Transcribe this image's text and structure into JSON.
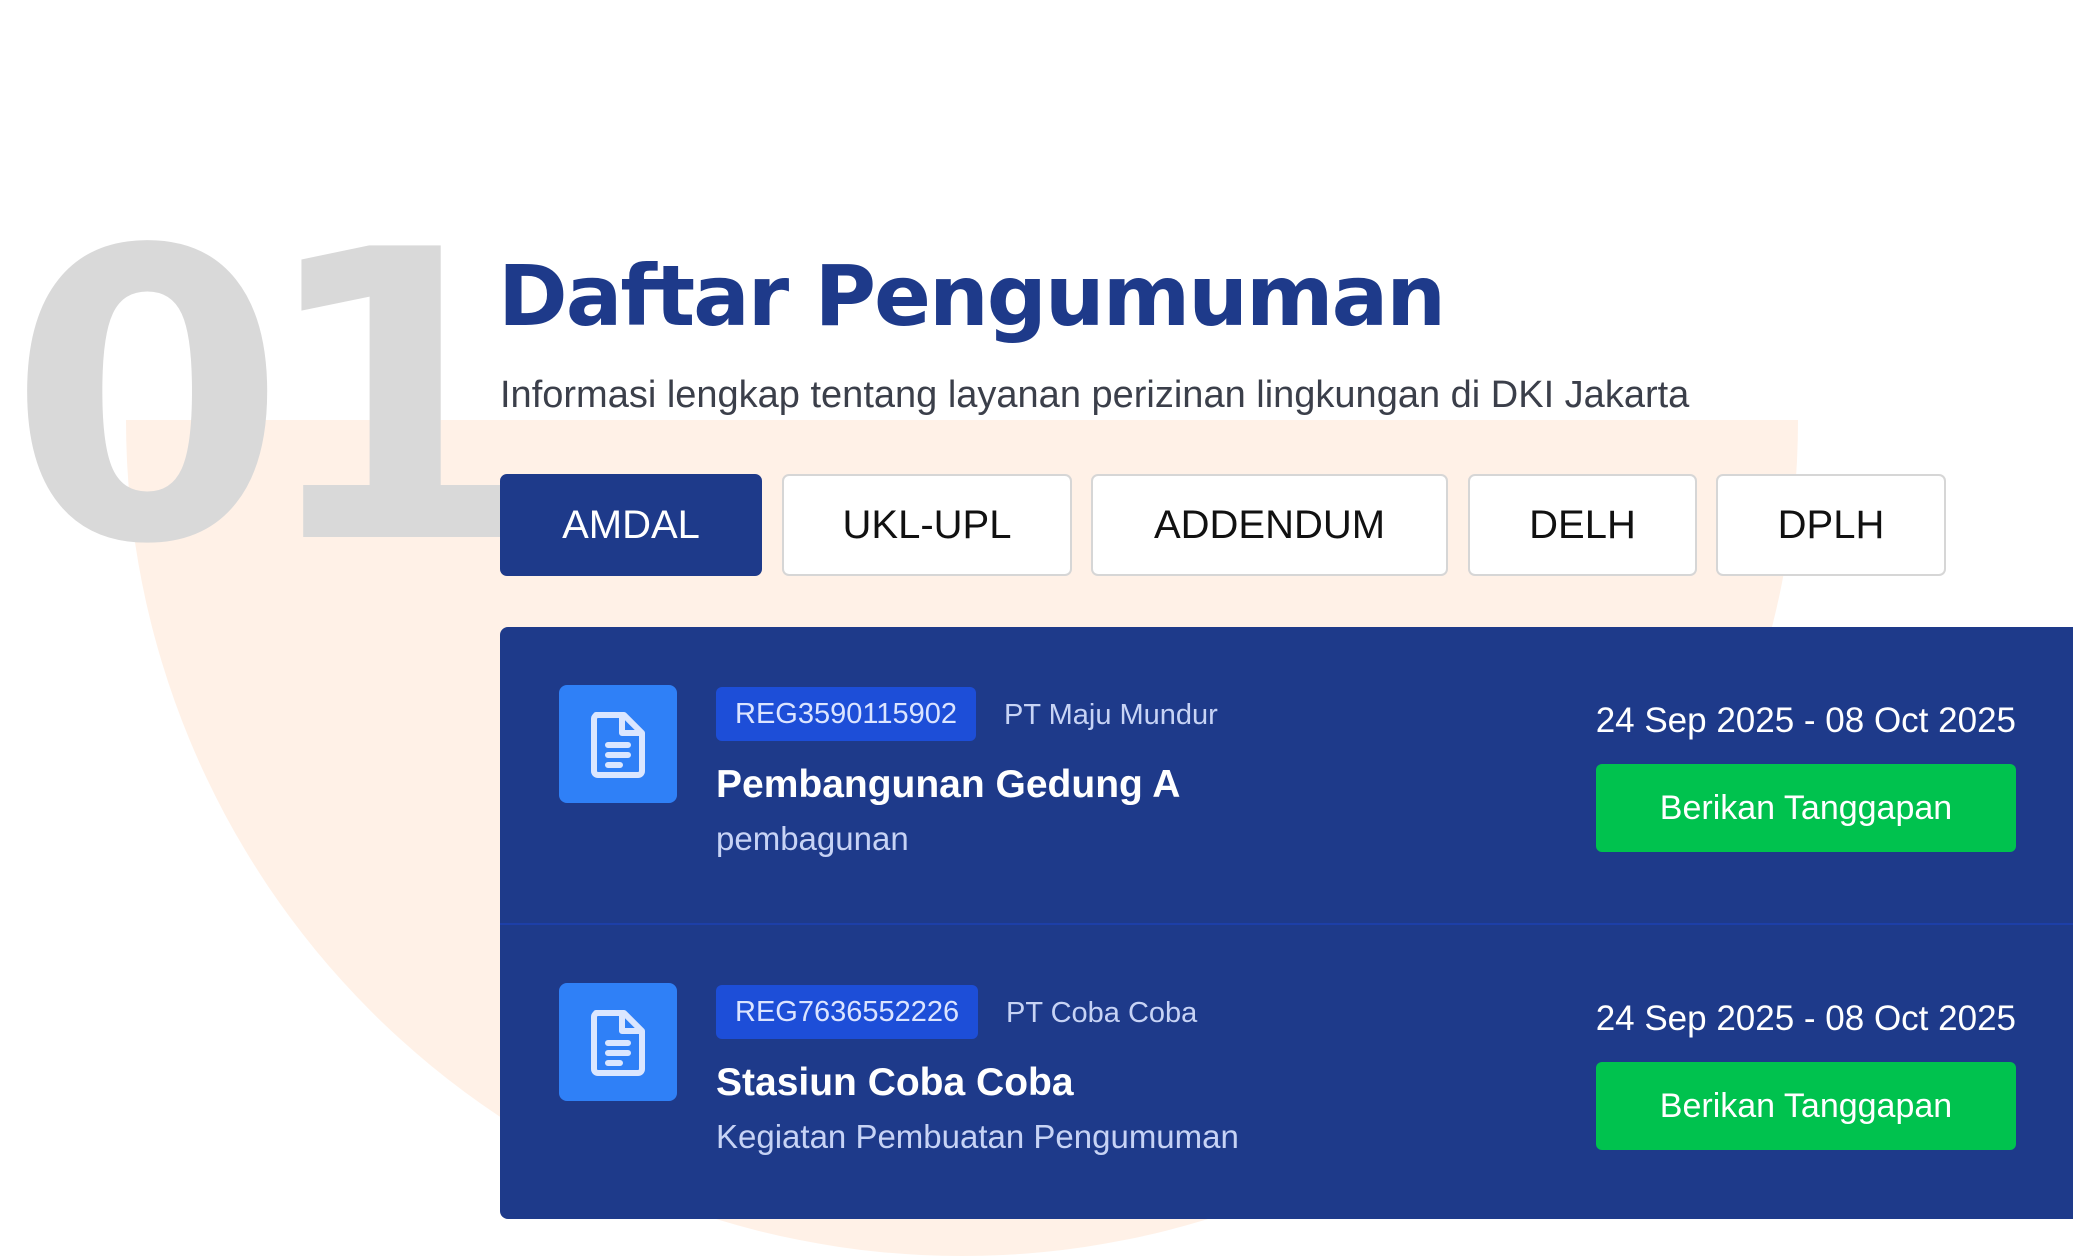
{
  "section": {
    "number": "01",
    "title": "Daftar Pengumuman",
    "subtitle": "Informasi lengkap tentang layanan perizinan lingkungan di DKI Jakarta"
  },
  "tabs": [
    {
      "label": "AMDAL",
      "active": true
    },
    {
      "label": "UKL-UPL",
      "active": false
    },
    {
      "label": "ADDENDUM",
      "active": false
    },
    {
      "label": "DELH",
      "active": false
    },
    {
      "label": "DPLH",
      "active": false
    }
  ],
  "announcements": [
    {
      "icon": "document-icon",
      "reg_number": "REG3590115902",
      "company": "PT Maju Mundur",
      "title": "Pembangunan Gedung A",
      "category": "pembagunan",
      "date_range": "24 Sep 2025 - 08 Oct 2025",
      "action_label": "Berikan Tanggapan"
    },
    {
      "icon": "document-icon",
      "reg_number": "REG7636552226",
      "company": "PT Coba Coba",
      "title": "Stasiun Coba Coba",
      "category": "Kegiatan Pembuatan Pengumuman",
      "date_range": "24 Sep 2025 - 08 Oct 2025",
      "action_label": "Berikan Tanggapan"
    }
  ],
  "colors": {
    "primary": "#1e3a8a",
    "badge": "#1d4ed8",
    "icon_tile": "#2f80f7",
    "action": "#00c24e",
    "background_shape": "#fff1e7",
    "number": "#d9d9d9"
  }
}
